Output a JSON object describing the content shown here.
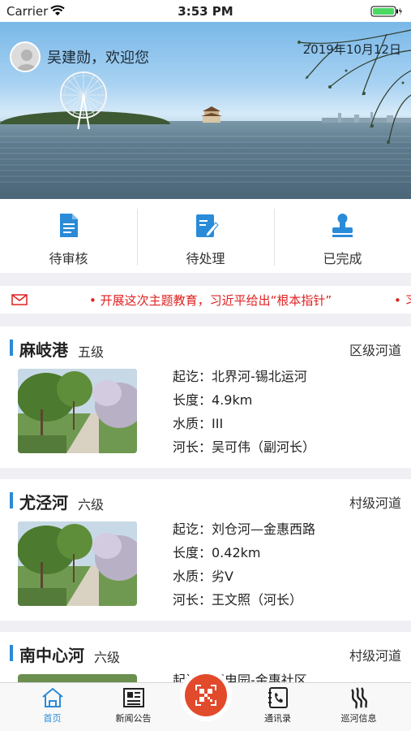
{
  "status_bar": {
    "carrier": "Carrier",
    "time": "3:53 PM"
  },
  "header": {
    "welcome": "吴建勋，欢迎您",
    "date": "2019年10月12日"
  },
  "quick_actions": [
    {
      "label": "待审核",
      "icon": "document-icon"
    },
    {
      "label": "待处理",
      "icon": "edit-icon"
    },
    {
      "label": "已完成",
      "icon": "stamp-icon"
    }
  ],
  "ticker": {
    "icon": "mail-icon",
    "text": "• 开展这次主题教育，习近平给出“根本指针”",
    "text2": "• 习"
  },
  "rivers": [
    {
      "name": "麻岐港",
      "level": "五级",
      "type": "区级河道",
      "rows": [
        "起讫：北界河-锡北运河",
        "长度：4.9km",
        "水质：III",
        "河长：吴可伟（副河长）"
      ]
    },
    {
      "name": "尤泾河",
      "level": "六级",
      "type": "村级河道",
      "rows": [
        "起讫：刘仓河—金惠西路",
        "长度：0.42km",
        "水质：劣V",
        "河长：王文照（河长）"
      ]
    },
    {
      "name": "南中心河",
      "level": "六级",
      "type": "村级河道",
      "rows": [
        "起讫：阳电园-金惠社区"
      ]
    }
  ],
  "tabs": [
    {
      "label": "首页",
      "icon": "home-icon",
      "active": true
    },
    {
      "label": "新闻公告",
      "icon": "newspaper-icon"
    },
    {
      "label": "通讯录",
      "icon": "contacts-icon"
    },
    {
      "label": "巡河信息",
      "icon": "river-patrol-icon"
    }
  ],
  "colors": {
    "accent": "#2a8bd8",
    "ticker": "#e02020",
    "scan": "#e24a2c"
  }
}
